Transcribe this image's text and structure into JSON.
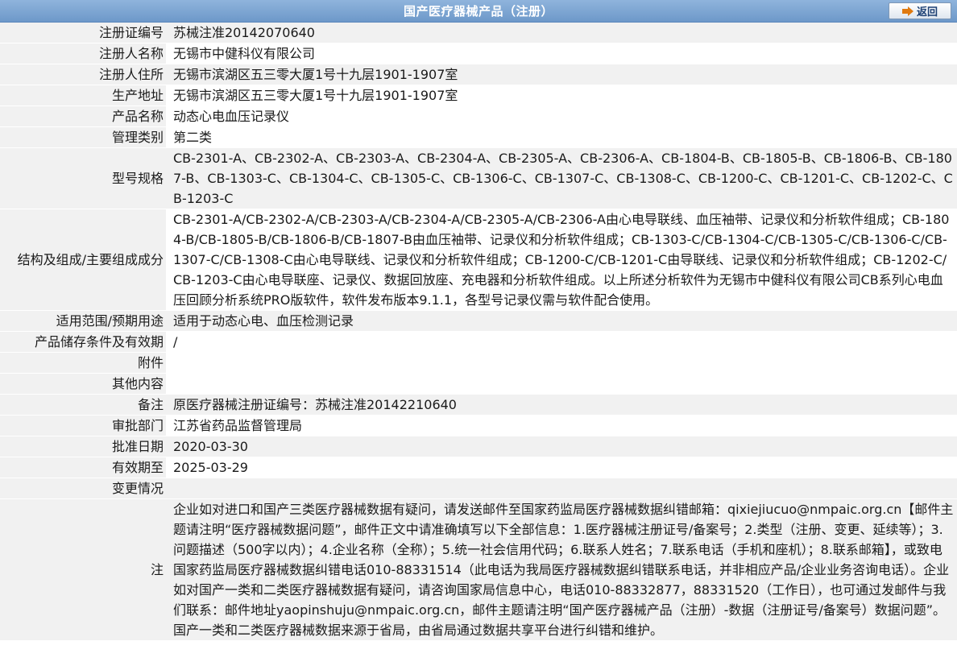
{
  "header": {
    "title": "国产医疗器械产品（注册）",
    "back_label": "返回"
  },
  "rows": {
    "reg_no": {
      "label": "注册证编号",
      "value": "苏械注准20142070640"
    },
    "registrant": {
      "label": "注册人名称",
      "value": "无锡市中健科仪有限公司"
    },
    "registrant_addr": {
      "label": "注册人住所",
      "value": "无锡市滨湖区五三零大厦1号十九层1901-1907室"
    },
    "production_addr": {
      "label": "生产地址",
      "value": "无锡市滨湖区五三零大厦1号十九层1901-1907室"
    },
    "product_name": {
      "label": "产品名称",
      "value": "动态心电血压记录仪"
    },
    "mgmt_class": {
      "label": "管理类别",
      "value": "第二类"
    },
    "model_spec": {
      "label": "型号规格",
      "value": "CB-2301-A、CB-2302-A、CB-2303-A、CB-2304-A、CB-2305-A、CB-2306-A、CB-1804-B、CB-1805-B、CB-1806-B、CB-1807-B、CB-1303-C、CB-1304-C、CB-1305-C、CB-1306-C、CB-1307-C、CB-1308-C、CB-1200-C、CB-1201-C、CB-1202-C、CB-1203-C"
    },
    "structure": {
      "label": "结构及组成/主要组成成分",
      "value": "CB-2301-A/CB-2302-A/CB-2303-A/CB-2304-A/CB-2305-A/CB-2306-A由心电导联线、血压袖带、记录仪和分析软件组成；CB-1804-B/CB-1805-B/CB-1806-B/CB-1807-B由血压袖带、记录仪和分析软件组成；CB-1303-C/CB-1304-C/CB-1305-C/CB-1306-C/CB-1307-C/CB-1308-C由心电导联线、记录仪和分析软件组成；CB-1200-C/CB-1201-C由导联线、记录仪和分析软件组成；CB-1202-C/CB-1203-C由心电导联座、记录仪、数据回放座、充电器和分析软件组成。以上所述分析软件为无锡市中健科仪有限公司CB系列心电血压回顾分析系统PRO版软件，软件发布版本9.1.1，各型号记录仪需与软件配合使用。"
    },
    "scope": {
      "label": "适用范围/预期用途",
      "value": "适用于动态心电、血压检测记录"
    },
    "storage": {
      "label": "产品储存条件及有效期",
      "value": "/"
    },
    "attachment": {
      "label": "附件",
      "value": ""
    },
    "other": {
      "label": "其他内容",
      "value": ""
    },
    "remark": {
      "label": "备注",
      "value": "原医疗器械注册证编号：苏械注准20142210640"
    },
    "approval_dept": {
      "label": "审批部门",
      "value": "江苏省药品监督管理局"
    },
    "approval_date": {
      "label": "批准日期",
      "value": "2020-03-30"
    },
    "valid_until": {
      "label": "有效期至",
      "value": "2025-03-29"
    },
    "change": {
      "label": "变更情况",
      "value": ""
    },
    "note": {
      "label": "注",
      "value": "企业如对进口和国产三类医疗器械数据有疑问，请发送邮件至国家药监局医疗器械数据纠错邮箱：qixiejiucuo@nmpaic.org.cn【邮件主题请注明“医疗器械数据问题”，邮件正文中请准确填写以下全部信息：1.医疗器械注册证号/备案号；2.类型（注册、变更、延续等）；3.问题描述（500字以内）；4.企业名称（全称）；5.统一社会信用代码；6.联系人姓名；7.联系电话（手机和座机）；8.联系邮箱】，或致电国家药监局医疗器械数据纠错电话010-88331514（此电话为我局医疗器械数据纠错联系电话，并非相应产品/企业业务咨询电话）。企业如对国产一类和二类医疗器械数据有疑问，请咨询国家局信息中心，电话010-88332877，88331520（工作日），也可通过发邮件与我们联系：邮件地址yaopinshuju@nmpaic.org.cn，邮件主题请注明“国产医疗器械产品（注册）-数据（注册证号/备案号）数据问题”。国产一类和二类医疗器械数据来源于省局，由省局通过数据共享平台进行纠错和维护。"
    }
  }
}
